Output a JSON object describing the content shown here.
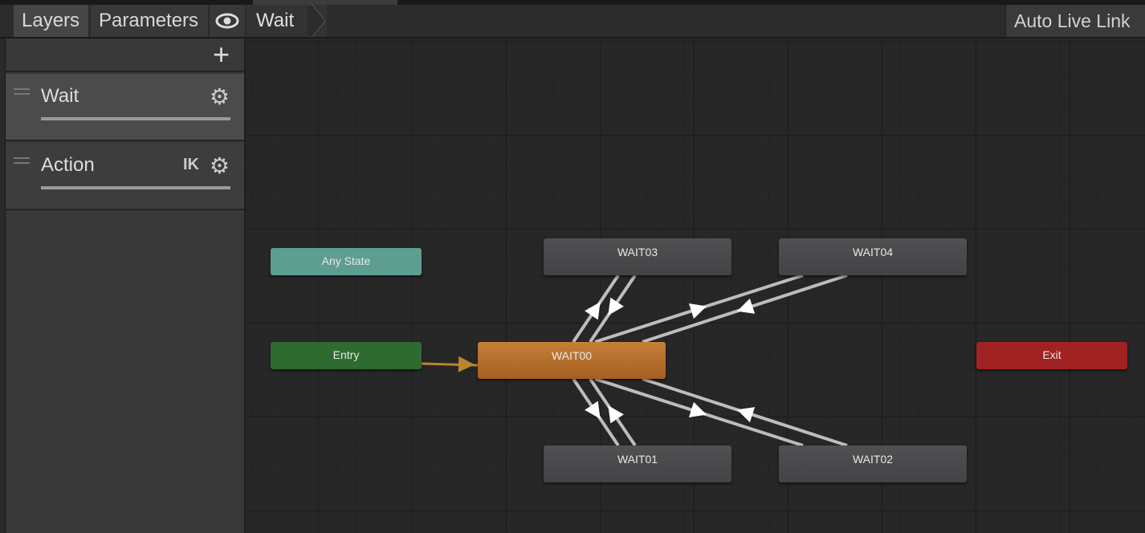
{
  "toolbar": {
    "tabs": [
      {
        "label": "Layers"
      },
      {
        "label": "Parameters"
      }
    ],
    "eye_icon": "eye-icon",
    "breadcrumb": "Wait",
    "auto_live_link": "Auto Live Link"
  },
  "sidebar": {
    "add_icon": "+",
    "layers": [
      {
        "name": "Wait",
        "ik": "",
        "selected": true,
        "weight": 1.0
      },
      {
        "name": "Action",
        "ik": "IK",
        "selected": false,
        "weight": 1.0
      }
    ]
  },
  "graph": {
    "nodes": {
      "any_state": "Any State",
      "entry": "Entry",
      "exit": "Exit",
      "wait00": "WAIT00",
      "wait01": "WAIT01",
      "wait02": "WAIT02",
      "wait03": "WAIT03",
      "wait04": "WAIT04"
    },
    "colors": {
      "any_state": "#5e9e90",
      "entry": "#2f6b30",
      "exit": "#a12222",
      "default_state": "#c57a32",
      "state": "#4b4b4e",
      "transition": "#bdbdbd",
      "entry_transition": "#b8862a"
    },
    "transitions": [
      [
        "entry",
        "wait00"
      ],
      [
        "wait00",
        "wait03"
      ],
      [
        "wait03",
        "wait00"
      ],
      [
        "wait00",
        "wait04"
      ],
      [
        "wait04",
        "wait00"
      ],
      [
        "wait00",
        "wait01"
      ],
      [
        "wait01",
        "wait00"
      ],
      [
        "wait00",
        "wait02"
      ],
      [
        "wait02",
        "wait00"
      ]
    ]
  }
}
